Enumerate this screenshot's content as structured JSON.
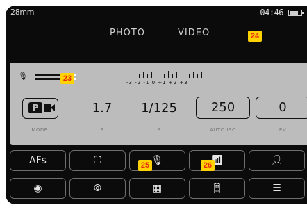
{
  "status_bar": {
    "focal_length": "28mm",
    "timer": "-04:46",
    "battery_icon": "battery-icon"
  },
  "tabs": [
    {
      "label": "PHOTO"
    },
    {
      "label": "VIDEO"
    }
  ],
  "markers": {
    "m23": "23",
    "m24": "24",
    "m25": "25",
    "m26": "26"
  },
  "audio": {
    "mic_icon": "microphone-icon",
    "scale_labels": "-3 -2 -1  0 +1 +2 +3",
    "level_top": 0.6,
    "level_bottom": 0.6
  },
  "parameters": {
    "mode": {
      "label": "MODE"
    },
    "aperture": {
      "value": "1.7",
      "label": "F"
    },
    "shutter": {
      "value": "1/125",
      "label": "S"
    },
    "iso": {
      "value": "250",
      "label": "AUTO ISO"
    },
    "ev": {
      "value": "0",
      "label": "EV"
    }
  },
  "buttons_row1": [
    {
      "label": "AFs",
      "icon": null
    },
    {
      "label": null,
      "icon": "focus-field-icon"
    },
    {
      "label": null,
      "icon": "microphone-icon"
    },
    {
      "label": null,
      "icon": "audio-level-icon"
    },
    {
      "label": null,
      "icon": "person-icon"
    }
  ],
  "buttons_row2": [
    {
      "label": null,
      "icon": "metering-icon"
    },
    {
      "label": null,
      "icon": "film-style-icon"
    },
    {
      "label": null,
      "icon": "video-format-icon"
    },
    {
      "label": null,
      "icon": "phone-connect-icon"
    },
    {
      "label": null,
      "icon": "menu-icon"
    }
  ]
}
